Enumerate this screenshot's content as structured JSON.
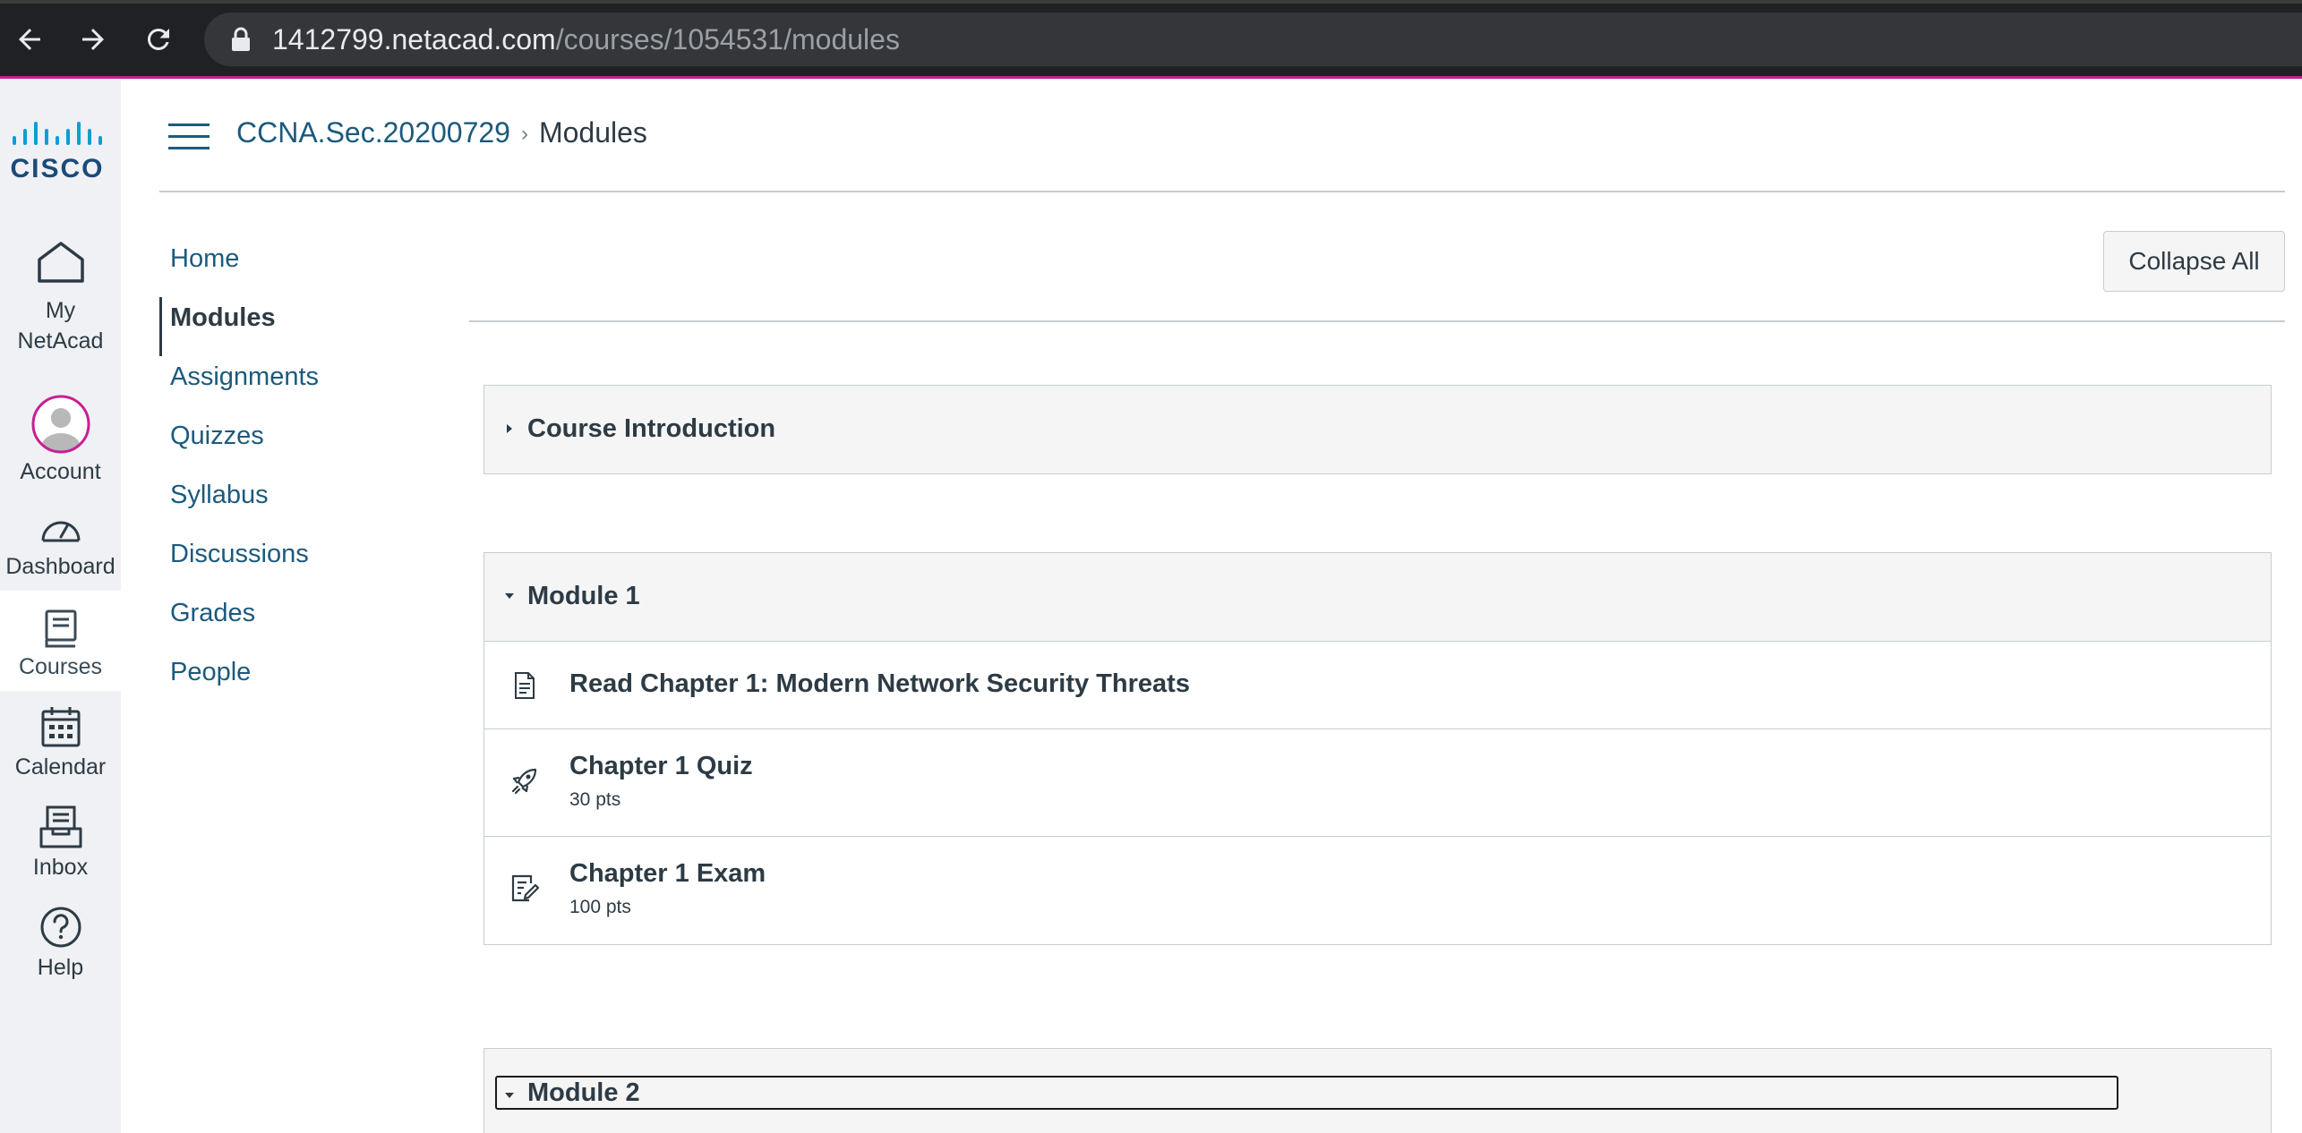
{
  "browser": {
    "url_host": "1412799.netacad.com",
    "url_path": "/courses/1054531/modules"
  },
  "global_nav": {
    "items": [
      {
        "label": "My NetAcad",
        "icon": "home-icon"
      },
      {
        "label": "Account",
        "icon": "avatar-icon"
      },
      {
        "label": "Dashboard",
        "icon": "dashboard-icon"
      },
      {
        "label": "Courses",
        "icon": "courses-icon",
        "active": true
      },
      {
        "label": "Calendar",
        "icon": "calendar-icon"
      },
      {
        "label": "Inbox",
        "icon": "inbox-icon"
      },
      {
        "label": "Help",
        "icon": "help-icon"
      }
    ],
    "logo": "cisco-logo"
  },
  "header": {
    "course_name": "CCNA.Sec.20200729",
    "separator": "›",
    "current_page": "Modules"
  },
  "course_nav": {
    "items": [
      "Home",
      "Modules",
      "Assignments",
      "Quizzes",
      "Syllabus",
      "Discussions",
      "Grades",
      "People"
    ],
    "active": "Modules"
  },
  "toolbar": {
    "collapse_all_label": "Collapse All"
  },
  "modules": [
    {
      "title": "Course Introduction",
      "expanded": false,
      "items": []
    },
    {
      "title": "Module 1",
      "expanded": true,
      "items": [
        {
          "title": "Read Chapter 1: Modern Network Security Threats",
          "type": "page",
          "icon": "document-icon",
          "points": ""
        },
        {
          "title": "Chapter 1 Quiz",
          "type": "quiz",
          "icon": "rocket-icon",
          "points": "30 pts"
        },
        {
          "title": "Chapter 1 Exam",
          "type": "assignment",
          "icon": "assignment-icon",
          "points": "100 pts"
        }
      ]
    },
    {
      "title": "Module 2",
      "expanded": true,
      "items": []
    }
  ],
  "colors": {
    "browser_bar": "#202124",
    "accent_line": "#c91e96",
    "link": "#1c5a7d",
    "text": "#2d3b45",
    "global_nav_bg": "#eff1f4",
    "module_header_bg": "#f5f5f5"
  }
}
